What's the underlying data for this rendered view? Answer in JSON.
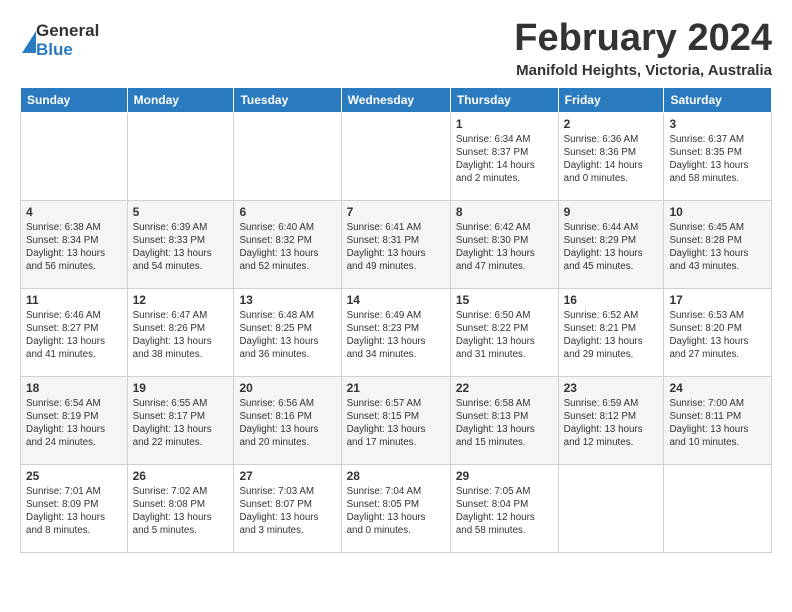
{
  "logo": {
    "general": "General",
    "blue": "Blue"
  },
  "header": {
    "month": "February 2024",
    "location": "Manifold Heights, Victoria, Australia"
  },
  "weekdays": [
    "Sunday",
    "Monday",
    "Tuesday",
    "Wednesday",
    "Thursday",
    "Friday",
    "Saturday"
  ],
  "weeks": [
    [
      {
        "day": "",
        "info": ""
      },
      {
        "day": "",
        "info": ""
      },
      {
        "day": "",
        "info": ""
      },
      {
        "day": "",
        "info": ""
      },
      {
        "day": "1",
        "info": "Sunrise: 6:34 AM\nSunset: 8:37 PM\nDaylight: 14 hours\nand 2 minutes."
      },
      {
        "day": "2",
        "info": "Sunrise: 6:36 AM\nSunset: 8:36 PM\nDaylight: 14 hours\nand 0 minutes."
      },
      {
        "day": "3",
        "info": "Sunrise: 6:37 AM\nSunset: 8:35 PM\nDaylight: 13 hours\nand 58 minutes."
      }
    ],
    [
      {
        "day": "4",
        "info": "Sunrise: 6:38 AM\nSunset: 8:34 PM\nDaylight: 13 hours\nand 56 minutes."
      },
      {
        "day": "5",
        "info": "Sunrise: 6:39 AM\nSunset: 8:33 PM\nDaylight: 13 hours\nand 54 minutes."
      },
      {
        "day": "6",
        "info": "Sunrise: 6:40 AM\nSunset: 8:32 PM\nDaylight: 13 hours\nand 52 minutes."
      },
      {
        "day": "7",
        "info": "Sunrise: 6:41 AM\nSunset: 8:31 PM\nDaylight: 13 hours\nand 49 minutes."
      },
      {
        "day": "8",
        "info": "Sunrise: 6:42 AM\nSunset: 8:30 PM\nDaylight: 13 hours\nand 47 minutes."
      },
      {
        "day": "9",
        "info": "Sunrise: 6:44 AM\nSunset: 8:29 PM\nDaylight: 13 hours\nand 45 minutes."
      },
      {
        "day": "10",
        "info": "Sunrise: 6:45 AM\nSunset: 8:28 PM\nDaylight: 13 hours\nand 43 minutes."
      }
    ],
    [
      {
        "day": "11",
        "info": "Sunrise: 6:46 AM\nSunset: 8:27 PM\nDaylight: 13 hours\nand 41 minutes."
      },
      {
        "day": "12",
        "info": "Sunrise: 6:47 AM\nSunset: 8:26 PM\nDaylight: 13 hours\nand 38 minutes."
      },
      {
        "day": "13",
        "info": "Sunrise: 6:48 AM\nSunset: 8:25 PM\nDaylight: 13 hours\nand 36 minutes."
      },
      {
        "day": "14",
        "info": "Sunrise: 6:49 AM\nSunset: 8:23 PM\nDaylight: 13 hours\nand 34 minutes."
      },
      {
        "day": "15",
        "info": "Sunrise: 6:50 AM\nSunset: 8:22 PM\nDaylight: 13 hours\nand 31 minutes."
      },
      {
        "day": "16",
        "info": "Sunrise: 6:52 AM\nSunset: 8:21 PM\nDaylight: 13 hours\nand 29 minutes."
      },
      {
        "day": "17",
        "info": "Sunrise: 6:53 AM\nSunset: 8:20 PM\nDaylight: 13 hours\nand 27 minutes."
      }
    ],
    [
      {
        "day": "18",
        "info": "Sunrise: 6:54 AM\nSunset: 8:19 PM\nDaylight: 13 hours\nand 24 minutes."
      },
      {
        "day": "19",
        "info": "Sunrise: 6:55 AM\nSunset: 8:17 PM\nDaylight: 13 hours\nand 22 minutes."
      },
      {
        "day": "20",
        "info": "Sunrise: 6:56 AM\nSunset: 8:16 PM\nDaylight: 13 hours\nand 20 minutes."
      },
      {
        "day": "21",
        "info": "Sunrise: 6:57 AM\nSunset: 8:15 PM\nDaylight: 13 hours\nand 17 minutes."
      },
      {
        "day": "22",
        "info": "Sunrise: 6:58 AM\nSunset: 8:13 PM\nDaylight: 13 hours\nand 15 minutes."
      },
      {
        "day": "23",
        "info": "Sunrise: 6:59 AM\nSunset: 8:12 PM\nDaylight: 13 hours\nand 12 minutes."
      },
      {
        "day": "24",
        "info": "Sunrise: 7:00 AM\nSunset: 8:11 PM\nDaylight: 13 hours\nand 10 minutes."
      }
    ],
    [
      {
        "day": "25",
        "info": "Sunrise: 7:01 AM\nSunset: 8:09 PM\nDaylight: 13 hours\nand 8 minutes."
      },
      {
        "day": "26",
        "info": "Sunrise: 7:02 AM\nSunset: 8:08 PM\nDaylight: 13 hours\nand 5 minutes."
      },
      {
        "day": "27",
        "info": "Sunrise: 7:03 AM\nSunset: 8:07 PM\nDaylight: 13 hours\nand 3 minutes."
      },
      {
        "day": "28",
        "info": "Sunrise: 7:04 AM\nSunset: 8:05 PM\nDaylight: 13 hours\nand 0 minutes."
      },
      {
        "day": "29",
        "info": "Sunrise: 7:05 AM\nSunset: 8:04 PM\nDaylight: 12 hours\nand 58 minutes."
      },
      {
        "day": "",
        "info": ""
      },
      {
        "day": "",
        "info": ""
      }
    ]
  ]
}
